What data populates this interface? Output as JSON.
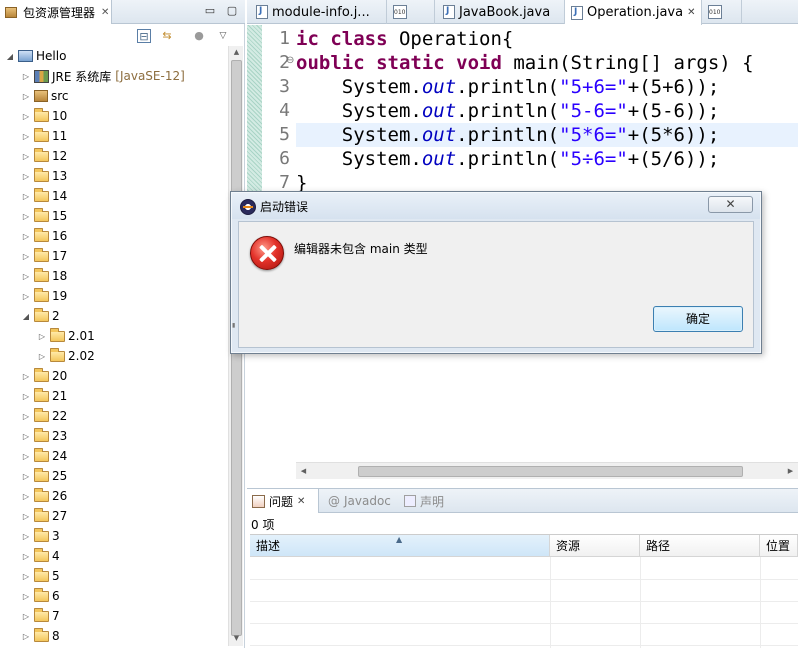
{
  "explorer": {
    "tab_label": "包资源管理器",
    "tree": [
      {
        "label": "Hello",
        "kind": "project",
        "expanded": true,
        "depth": 0
      },
      {
        "label": "JRE 系统库",
        "decoration": "[JavaSE-12]",
        "kind": "jre",
        "expanded": false,
        "depth": 1
      },
      {
        "label": "src",
        "kind": "package-root",
        "expanded": false,
        "depth": 1
      },
      {
        "label": "10",
        "kind": "folder",
        "expanded": false,
        "depth": 1
      },
      {
        "label": "11",
        "kind": "folder",
        "expanded": false,
        "depth": 1
      },
      {
        "label": "12",
        "kind": "folder",
        "expanded": false,
        "depth": 1
      },
      {
        "label": "13",
        "kind": "folder",
        "expanded": false,
        "depth": 1
      },
      {
        "label": "14",
        "kind": "folder",
        "expanded": false,
        "depth": 1
      },
      {
        "label": "15",
        "kind": "folder",
        "expanded": false,
        "depth": 1
      },
      {
        "label": "16",
        "kind": "folder",
        "expanded": false,
        "depth": 1
      },
      {
        "label": "17",
        "kind": "folder",
        "expanded": false,
        "depth": 1
      },
      {
        "label": "18",
        "kind": "folder",
        "expanded": false,
        "depth": 1
      },
      {
        "label": "19",
        "kind": "folder",
        "expanded": false,
        "depth": 1
      },
      {
        "label": "2",
        "kind": "folder",
        "expanded": true,
        "depth": 1
      },
      {
        "label": "2.01",
        "kind": "folder",
        "expanded": false,
        "depth": 2
      },
      {
        "label": "2.02",
        "kind": "folder",
        "expanded": false,
        "depth": 2
      },
      {
        "label": "20",
        "kind": "folder",
        "expanded": false,
        "depth": 1
      },
      {
        "label": "21",
        "kind": "folder",
        "expanded": false,
        "depth": 1
      },
      {
        "label": "22",
        "kind": "folder",
        "expanded": false,
        "depth": 1
      },
      {
        "label": "23",
        "kind": "folder",
        "expanded": false,
        "depth": 1
      },
      {
        "label": "24",
        "kind": "folder",
        "expanded": false,
        "depth": 1
      },
      {
        "label": "25",
        "kind": "folder",
        "expanded": false,
        "depth": 1
      },
      {
        "label": "26",
        "kind": "folder",
        "expanded": false,
        "depth": 1
      },
      {
        "label": "27",
        "kind": "folder",
        "expanded": false,
        "depth": 1
      },
      {
        "label": "3",
        "kind": "folder",
        "expanded": false,
        "depth": 1
      },
      {
        "label": "4",
        "kind": "folder",
        "expanded": false,
        "depth": 1
      },
      {
        "label": "5",
        "kind": "folder",
        "expanded": false,
        "depth": 1
      },
      {
        "label": "6",
        "kind": "folder",
        "expanded": false,
        "depth": 1
      },
      {
        "label": "7",
        "kind": "folder",
        "expanded": false,
        "depth": 1
      },
      {
        "label": "8",
        "kind": "folder",
        "expanded": false,
        "depth": 1
      }
    ]
  },
  "editor": {
    "tabs": [
      {
        "label": "module-info.j...",
        "icon": "java-file-icon",
        "active": false
      },
      {
        "label": "",
        "icon": "class-file-icon",
        "active": false
      },
      {
        "label": "JavaBook.java",
        "icon": "java-file-icon",
        "active": false
      },
      {
        "label": "Operation.java",
        "icon": "java-file-icon",
        "active": true
      },
      {
        "label": "",
        "icon": "class-file-icon",
        "active": false
      }
    ],
    "highlighted_line": 5,
    "lines": [
      {
        "number": "1",
        "tokens": [
          {
            "t": "ic ",
            "c": "kw"
          },
          {
            "t": "class ",
            "c": "kw"
          },
          {
            "t": "Operation{",
            "c": ""
          }
        ]
      },
      {
        "number": "2",
        "tokens": [
          {
            "t": "oublic ",
            "c": "kw"
          },
          {
            "t": "static ",
            "c": "kw"
          },
          {
            "t": "void ",
            "c": "kw"
          },
          {
            "t": "main(String[] args) {",
            "c": ""
          }
        ]
      },
      {
        "number": "3",
        "tokens": [
          {
            "t": "    System.",
            "c": ""
          },
          {
            "t": "out",
            "c": "fld"
          },
          {
            "t": ".println(",
            "c": ""
          },
          {
            "t": "\"5+6=\"",
            "c": "str"
          },
          {
            "t": "+(5+6));",
            "c": ""
          }
        ]
      },
      {
        "number": "4",
        "tokens": [
          {
            "t": "    System.",
            "c": ""
          },
          {
            "t": "out",
            "c": "fld"
          },
          {
            "t": ".println(",
            "c": ""
          },
          {
            "t": "\"5-6=\"",
            "c": "str"
          },
          {
            "t": "+(5-6));",
            "c": ""
          }
        ]
      },
      {
        "number": "5",
        "tokens": [
          {
            "t": "    System.",
            "c": ""
          },
          {
            "t": "out",
            "c": "fld"
          },
          {
            "t": ".println(",
            "c": ""
          },
          {
            "t": "\"5*6=\"",
            "c": "str"
          },
          {
            "t": "+(5*6));",
            "c": ""
          }
        ]
      },
      {
        "number": "6",
        "tokens": [
          {
            "t": "    System.",
            "c": ""
          },
          {
            "t": "out",
            "c": "fld"
          },
          {
            "t": ".println(",
            "c": ""
          },
          {
            "t": "\"5÷6=\"",
            "c": "str"
          },
          {
            "t": "+(5/6));",
            "c": ""
          }
        ]
      },
      {
        "number": "7",
        "tokens": [
          {
            "t": "}",
            "c": ""
          }
        ]
      }
    ]
  },
  "problems": {
    "tabs": [
      {
        "label": "问题",
        "active": true
      },
      {
        "label": "Javadoc",
        "active": false
      },
      {
        "label": "声明",
        "active": false
      }
    ],
    "count_label": "0 项",
    "columns": [
      "描述",
      "资源",
      "路径",
      "位置"
    ]
  },
  "dialog": {
    "title": "启动错误",
    "message": "编辑器未包含 main 类型",
    "ok_label": "确定",
    "close_glyph": "✕"
  },
  "colors": {
    "keyword": "#7f0055",
    "field": "#0000c0",
    "string": "#2a00ff",
    "highlight_line": "#e8f2fe",
    "error": "#e3322a"
  }
}
